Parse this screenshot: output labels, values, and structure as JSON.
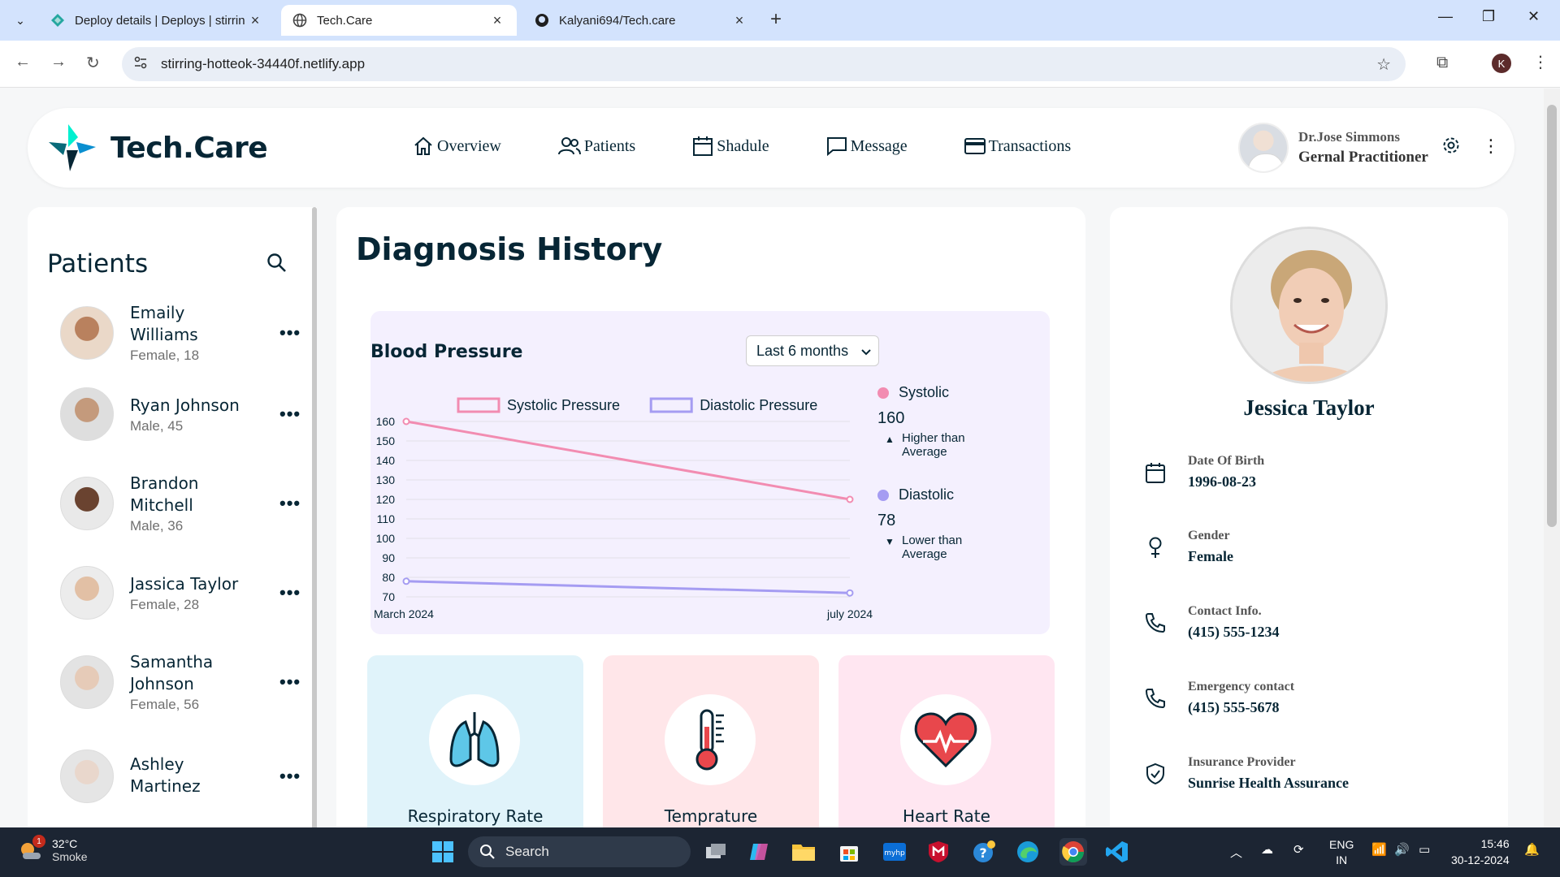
{
  "browser": {
    "tabs": [
      {
        "title": "Deploy details | Deploys | stirrin",
        "active": false
      },
      {
        "title": "Tech.Care",
        "active": true
      },
      {
        "title": "Kalyani694/Tech.care",
        "active": false
      }
    ],
    "url": "stirring-hotteok-34440f.netlify.app",
    "profile_initial": "K"
  },
  "header": {
    "logo_text": "Tech.Care",
    "nav": [
      {
        "label": "Overview",
        "icon": "home-icon"
      },
      {
        "label": "Patients",
        "icon": "users-icon"
      },
      {
        "label": "Shadule",
        "icon": "calendar-icon"
      },
      {
        "label": "Message",
        "icon": "chat-icon"
      },
      {
        "label": "Transactions",
        "icon": "credit-card-icon"
      }
    ],
    "doctor": {
      "name": "Dr.Jose Simmons",
      "role": "Gernal Practitioner"
    }
  },
  "patients": {
    "title": "Patients",
    "list": [
      {
        "name": "Emaily Williams",
        "meta": "Female, 18"
      },
      {
        "name": "Ryan Johnson",
        "meta": "Male, 45"
      },
      {
        "name": "Brandon Mitchell",
        "meta": "Male, 36"
      },
      {
        "name": "Jassica Taylor",
        "meta": "Female, 28"
      },
      {
        "name": "Samantha Johnson",
        "meta": "Female, 56"
      },
      {
        "name": "Ashley Martinez",
        "meta": ""
      }
    ]
  },
  "diagnosis": {
    "title": "Diagnosis History",
    "bp_title": "Blood Pressure",
    "range_select": "Last 6 months",
    "systolic": {
      "label": "Systolic",
      "value": "160",
      "note": "Higher than Average",
      "color": "#e66fd2"
    },
    "diastolic": {
      "label": "Diastolic",
      "value": "78",
      "note": "Lower than Average",
      "color": "#8c6fe6"
    },
    "vitals": [
      {
        "label": "Respiratory Rate",
        "bg": "#e0f3fa"
      },
      {
        "label": "Temprature",
        "bg": "#ffe6e9"
      },
      {
        "label": "Heart Rate",
        "bg": "#ffe6f1"
      }
    ]
  },
  "chart_data": {
    "type": "line",
    "x": [
      "March 2024",
      "july 2024"
    ],
    "series": [
      {
        "name": "Systolic Pressure",
        "values": [
          160,
          120
        ],
        "color": "#f28cb1"
      },
      {
        "name": "Diastolic Pressure",
        "values": [
          78,
          72
        ],
        "color": "#a59cf2"
      }
    ],
    "yticks": [
      160,
      150,
      140,
      130,
      120,
      110,
      100,
      90,
      80,
      70
    ],
    "ylim": [
      70,
      160
    ],
    "grid": true,
    "legend": "top"
  },
  "profile": {
    "name": "Jessica Taylor",
    "fields": [
      {
        "label": "Date Of Birth",
        "value": "1996-08-23",
        "icon": "calendar-icon"
      },
      {
        "label": "Gender",
        "value": "Female",
        "icon": "female-icon"
      },
      {
        "label": "Contact Info.",
        "value": "(415) 555-1234",
        "icon": "phone-icon"
      },
      {
        "label": "Emergency contact",
        "value": "(415) 555-5678",
        "icon": "phone-icon"
      },
      {
        "label": "Insurance Provider",
        "value": "Sunrise Health Assurance",
        "icon": "shield-icon"
      }
    ]
  },
  "taskbar": {
    "weather_temp": "32°C",
    "weather_cond": "Smoke",
    "weather_badge": "1",
    "search_placeholder": "Search",
    "lang1": "ENG",
    "lang2": "IN",
    "time": "15:46",
    "date": "30-12-2024"
  }
}
